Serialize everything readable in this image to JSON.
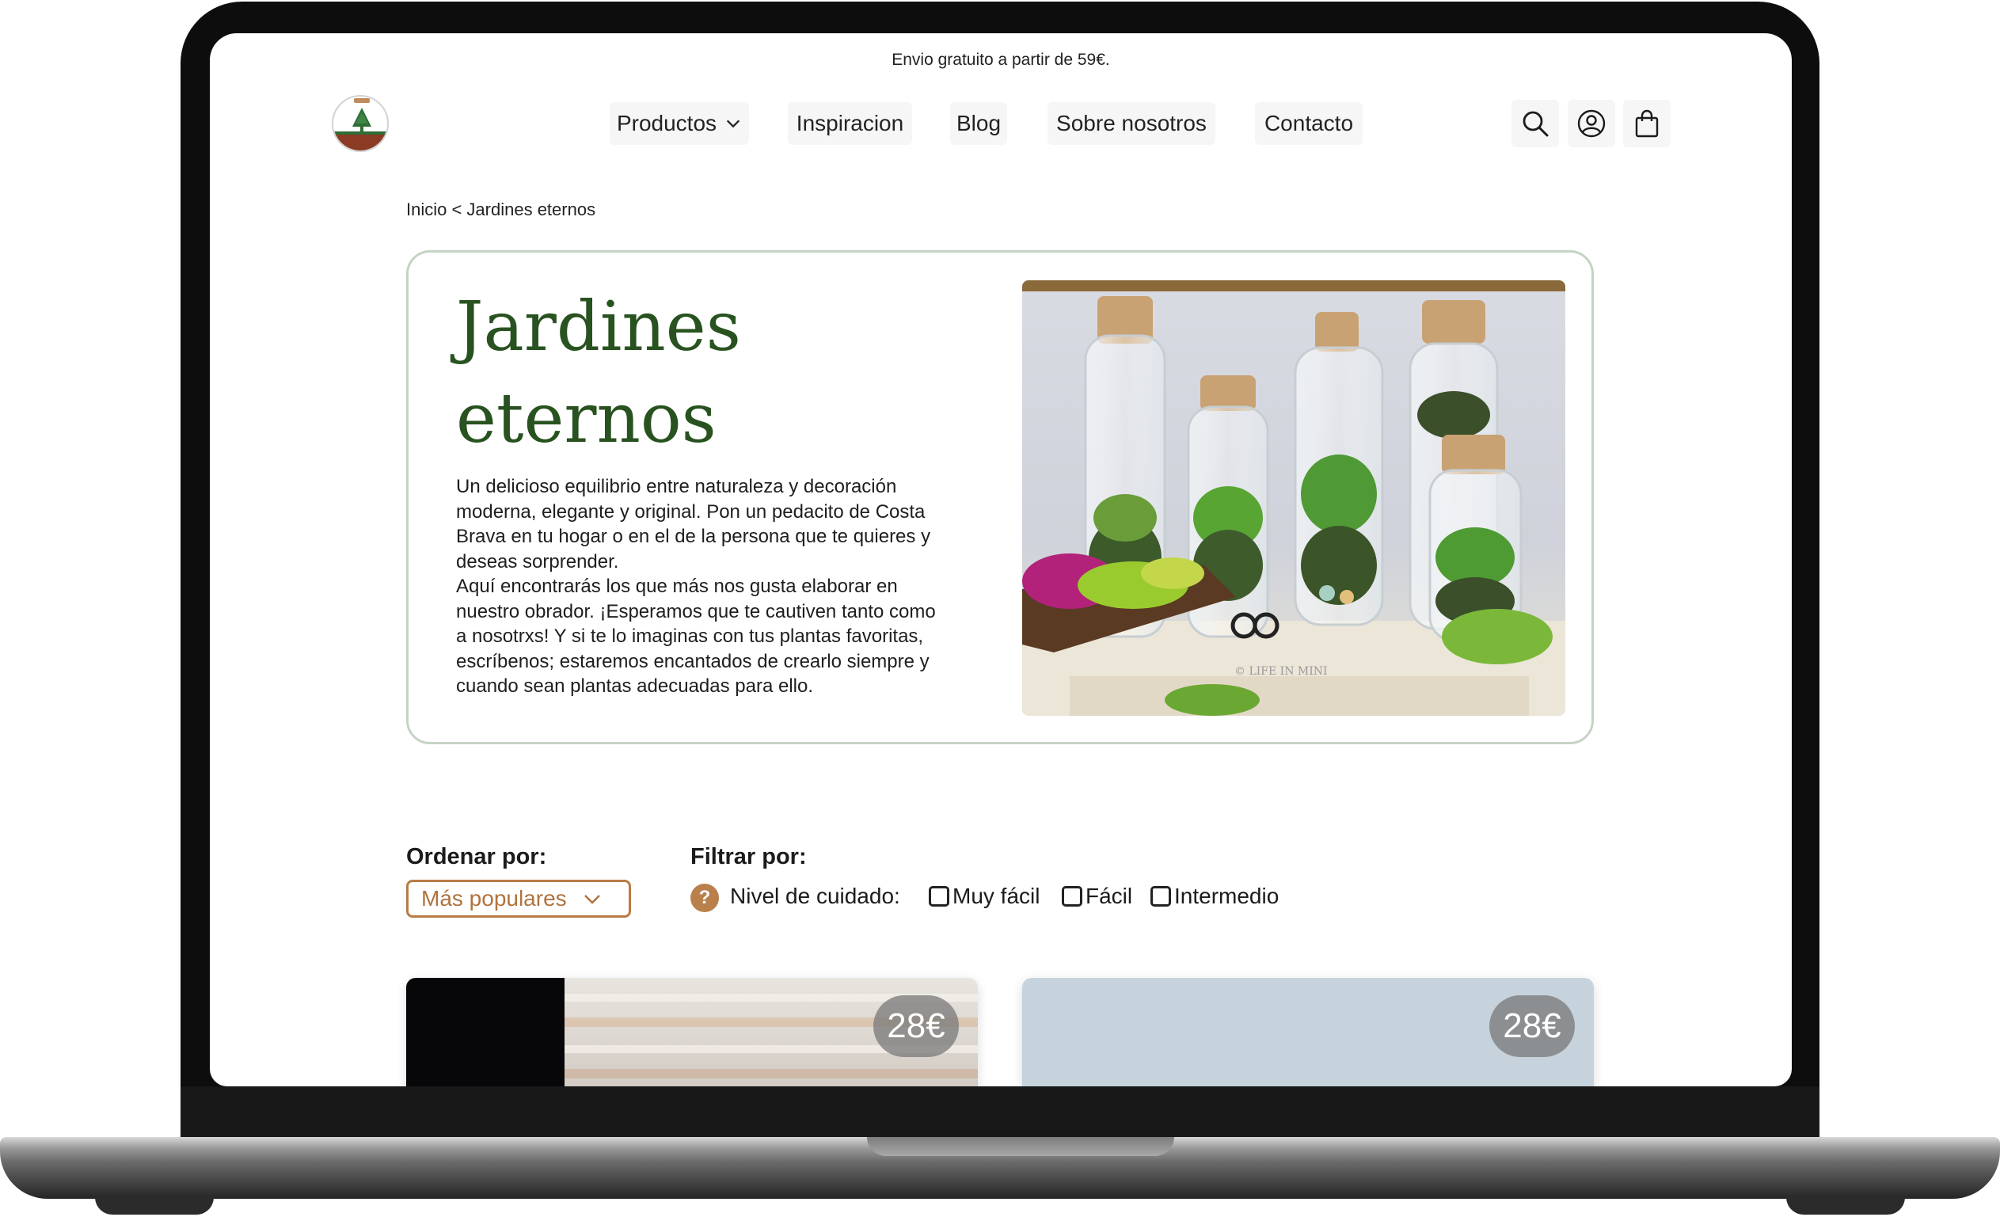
{
  "promo": {
    "text": "Envio gratuito a partir de 59€."
  },
  "header": {
    "nav": [
      {
        "label": "Productos"
      },
      {
        "label": "Inspiracion"
      },
      {
        "label": "Blog"
      },
      {
        "label": "Sobre nosotros"
      },
      {
        "label": "Contacto"
      }
    ],
    "icons": [
      "search-icon",
      "user-icon",
      "shopping-bag-icon"
    ]
  },
  "breadcrumb": {
    "text": "Inicio < Jardines eternos"
  },
  "hero": {
    "title": "Jardines eternos",
    "description": "Un  delicioso equilibrio entre naturaleza y decoración\nmoderna, elegante y  original. Pon un pedacito de Costa\nBrava en tu hogar o en el de la  persona que te quieres y\ndeseas sorprender.\nAquí encontrarás los que más nos gusta elaborar en\nnuestro obrador. ¡Esperamos que te cautiven tanto como\na nosotrxs! Y si te lo imaginas  con tus plantas favoritas,\nescríbenos; estaremos encantados de  crearlo siempre y\ncuando sean plantas adecuadas para ello.",
    "image_watermark": "© LIFE IN MINI"
  },
  "sort": {
    "label": "Ordenar por:",
    "selected": "Más populares"
  },
  "filter": {
    "label": "Filtrar por:",
    "help_symbol": "?",
    "care_label": "Nivel de cuidado:",
    "options": [
      {
        "label": "Muy fácil",
        "checked": false
      },
      {
        "label": "Fácil",
        "checked": false
      },
      {
        "label": "Intermedio",
        "checked": false
      }
    ]
  },
  "products": [
    {
      "price": "28€"
    },
    {
      "price": "28€"
    }
  ],
  "colors": {
    "brand_green": "#28521f",
    "accent_brown": "#b97b45",
    "card_border": "#c5d3c5"
  }
}
